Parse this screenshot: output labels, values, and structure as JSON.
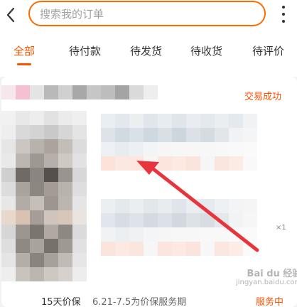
{
  "search": {
    "placeholder": "搜索我的订单"
  },
  "tabs": [
    {
      "label": "全部",
      "active": true
    },
    {
      "label": "待付款",
      "active": false
    },
    {
      "label": "待发货",
      "active": false
    },
    {
      "label": "待收货",
      "active": false
    },
    {
      "label": "待评价",
      "active": false
    }
  ],
  "order": {
    "status": "交易成功",
    "quantity": "×1",
    "guarantee_label": "15天价保",
    "guarantee_period": "6.21-7.5为价保服务期",
    "service_status": "服务中"
  },
  "watermark": {
    "brand": "Bai du 经验",
    "url": "jingyan.baidu.com"
  },
  "colors": {
    "accent": "#ff5000",
    "search_border": "#ff6a00",
    "annotation_arrow": "#e8343c"
  },
  "icons": {
    "back": "chevron-left-icon",
    "more": "more-vertical-icon"
  }
}
